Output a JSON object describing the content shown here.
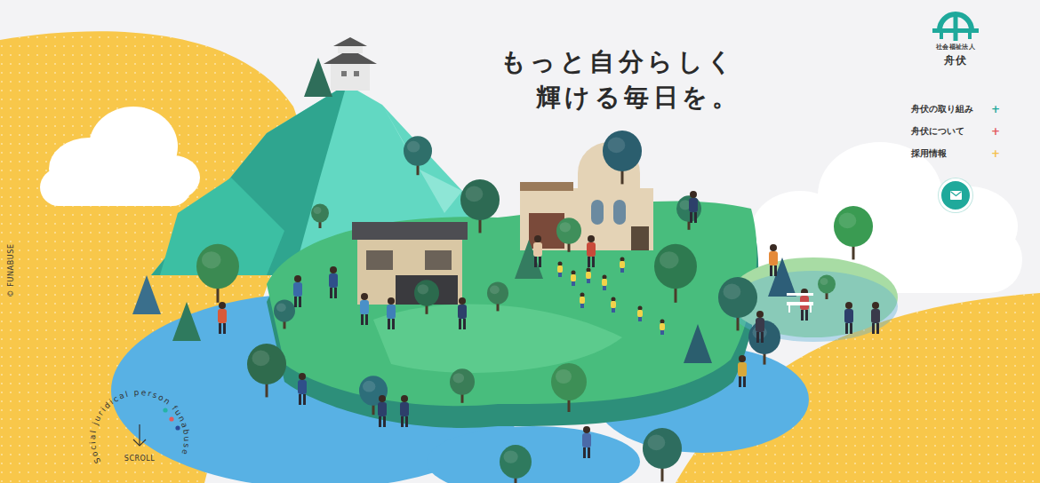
{
  "brand": {
    "kicker": "社会福祉法人",
    "name": "舟伏"
  },
  "headline": [
    "もっと自分らしく",
    "輝ける毎日を。"
  ],
  "nav": [
    {
      "label": "舟伏の取り組み",
      "mark": "+",
      "color": "#1fa99b"
    },
    {
      "label": "舟伏について",
      "mark": "+",
      "color": "#e2575a"
    },
    {
      "label": "採用情報",
      "mark": "+",
      "color": "#f5c04a"
    }
  ],
  "copyright": "© FUNABUSE",
  "scroll": {
    "label": "SCROLL",
    "ring": "Social juridical person funabuse",
    "dots": [
      {
        "color": "#25b3a6"
      },
      {
        "color": "#e35a5a"
      },
      {
        "color": "#2b4c9b"
      }
    ]
  }
}
